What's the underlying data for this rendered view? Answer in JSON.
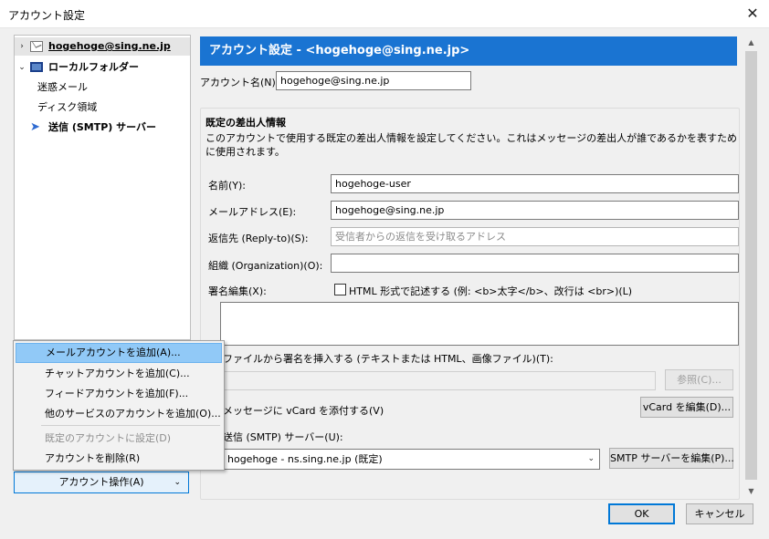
{
  "window": {
    "title": "アカウント設定",
    "close_glyph": "✕"
  },
  "tree": {
    "account": "hogehoge@sing.ne.jp",
    "local_folders": "ローカルフォルダー",
    "junk": "迷惑メール",
    "disk": "ディスク領域",
    "smtp": "送信 (SMTP) サーバー",
    "icons": [
      "mail-icon",
      "local-folder-icon",
      "send-icon"
    ]
  },
  "panel": {
    "banner": "アカウント設定 - <hogehoge@sing.ne.jp>",
    "account_name_label": "アカウント名(N):",
    "account_name_value": "hogehoge@sing.ne.jp",
    "identity": {
      "heading": "既定の差出人情報",
      "desc": "このアカウントで使用する既定の差出人情報を設定してください。これはメッセージの差出人が誰であるかを表すために使用されます。",
      "name_label": "名前(Y):",
      "name_value": "hogehoge-user",
      "email_label": "メールアドレス(E):",
      "email_value": "hogehoge@sing.ne.jp",
      "replyto_label": "返信先 (Reply-to)(S):",
      "replyto_placeholder": "受信者からの返信を受け取るアドレス",
      "org_label": "組織 (Organization)(O):",
      "org_value": "",
      "sig_label": "署名編集(X):",
      "html_check_label": "HTML 形式で記述する (例: <b>太字</b>、改行は <br>)(L)",
      "file_sig_label": "ファイルから署名を挿入する (テキストまたは HTML、画像ファイル)(T):",
      "browse_button": "参照(C)...",
      "vcard_label": "メッセージに vCard を添付する(V)",
      "vcard_button": "vCard を編集(D)...",
      "smtp_label": "送信 (SMTP) サーバー(U):",
      "smtp_value": "hogehoge - ns.sing.ne.jp (既定)",
      "smtp_button": "SMTP サーバーを編集(P)..."
    }
  },
  "account_actions_button": "アカウント操作(A)",
  "menu": {
    "items": [
      "メールアカウントを追加(A)...",
      "チャットアカウントを追加(C)...",
      "フィードアカウントを追加(F)...",
      "他のサービスのアカウントを追加(O)...",
      "既定のアカウントに設定(D)",
      "アカウントを削除(R)"
    ]
  },
  "footer": {
    "ok": "OK",
    "cancel": "キャンセル"
  },
  "colors": {
    "accent": "#1a74d2",
    "menu_highlight": "#91c9f7",
    "focus": "#0078d7"
  }
}
